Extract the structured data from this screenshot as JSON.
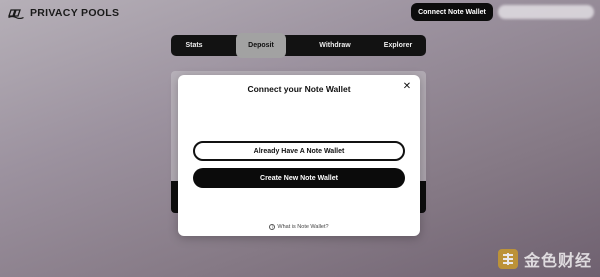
{
  "header": {
    "brand": "PRIVACY POOLS",
    "connect_button": "Connect Note Wallet"
  },
  "nav": {
    "tabs": [
      {
        "label": "Stats"
      },
      {
        "label": "Deposit",
        "active": true
      },
      {
        "label": "Withdraw"
      },
      {
        "label": "Explorer"
      }
    ]
  },
  "modal": {
    "title": "Connect your Note Wallet",
    "close": "✕",
    "have_wallet_button": "Already Have A Note Wallet",
    "create_wallet_button": "Create New Note Wallet",
    "help_icon": "?",
    "help_link": "What is Note Wallet?"
  },
  "watermark": {
    "text": "金色财经"
  },
  "colors": {
    "accent_dark": "#0c0c0c",
    "active_tab": "#a2a2a2",
    "watermark_gold": "#c99a2e"
  }
}
